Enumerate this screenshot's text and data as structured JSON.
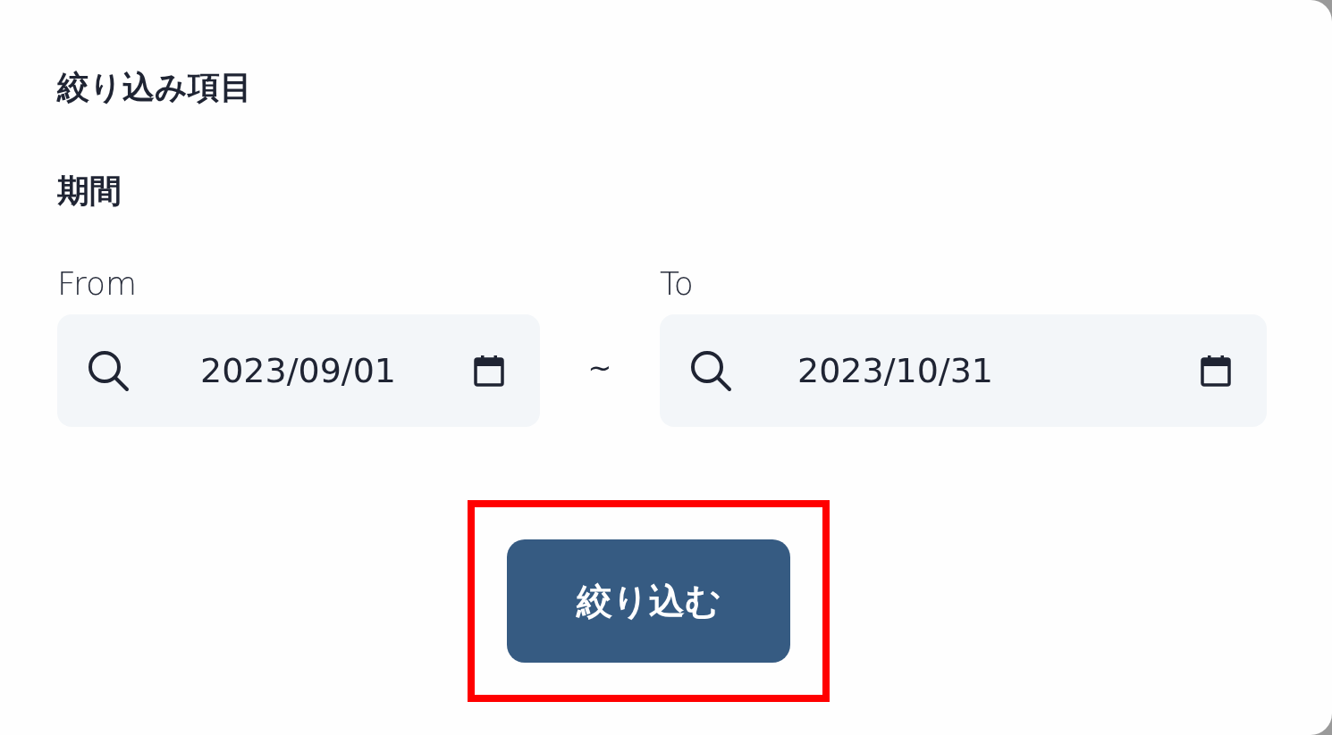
{
  "heading": "絞り込み項目",
  "section": "期間",
  "date_range": {
    "from": {
      "label": "From",
      "value": "2023/09/01"
    },
    "separator": "~",
    "to": {
      "label": "To",
      "value": "2023/10/31"
    }
  },
  "submit_button": {
    "label": "絞り込む",
    "highlighted": true
  }
}
